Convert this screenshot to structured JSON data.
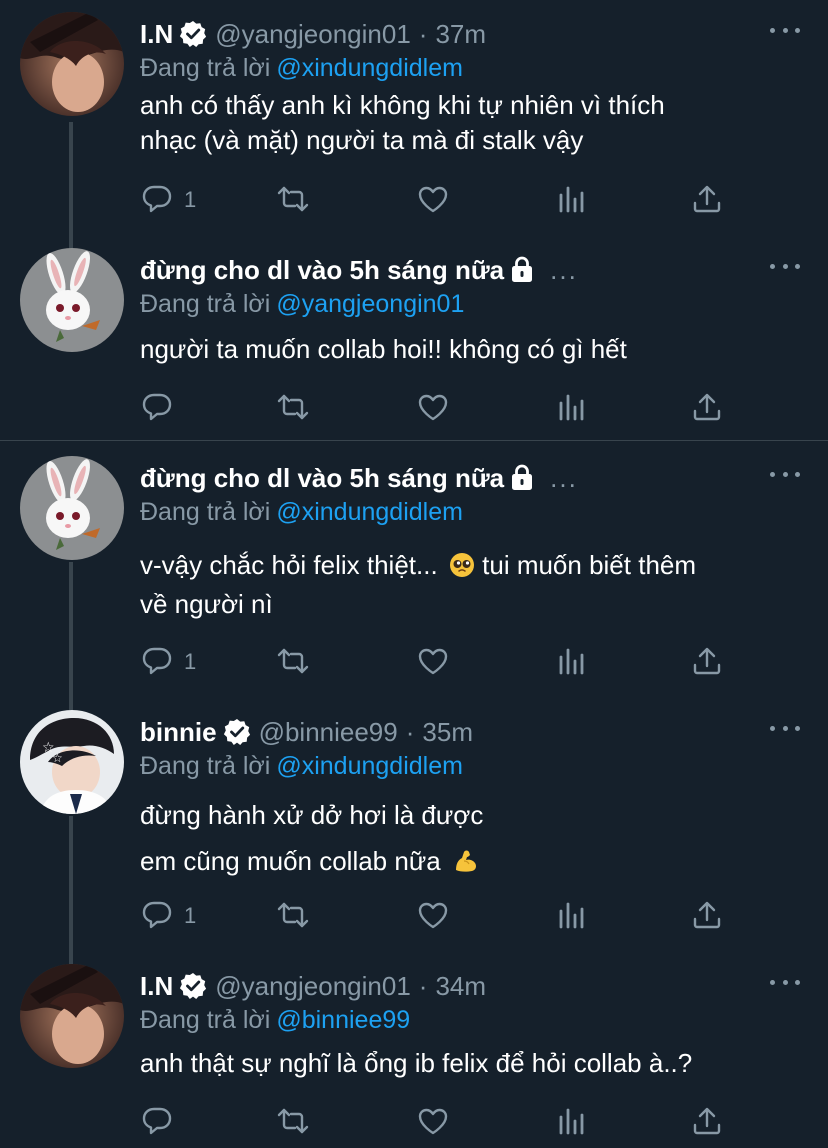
{
  "tweets": [
    {
      "name": "I.N",
      "verified": true,
      "handle": "@yangjeongin01",
      "time": "37m",
      "reply_prefix": "Đang trả lời",
      "reply_to": "@xindungdidlem",
      "lines": [
        "anh có thấy anh kì không khi tự nhiên vì thích",
        "nhạc (và mặt) người ta mà đi stalk vậy"
      ],
      "reply_count": "1"
    },
    {
      "name": "đừng cho dl vào 5h sáng nữa",
      "protected": true,
      "name_truncated": "...",
      "reply_prefix": "Đang trả lời",
      "reply_to": "@yangjeongin01",
      "lines": [
        "người ta muốn collab hoi!! không có gì hết"
      ],
      "reply_count": ""
    },
    {
      "name": "đừng cho dl vào 5h sáng nữa",
      "protected": true,
      "name_truncated": "...",
      "reply_prefix": "Đang trả lời",
      "reply_to": "@xindungdidlem",
      "lines": [
        "v-vậy chắc hỏi felix thiệt... ",
        "về người nì"
      ],
      "line1_after_emoji": " tui muốn biết thêm",
      "emoji": "pleading-face",
      "reply_count": "1"
    },
    {
      "name": "binnie",
      "verified": true,
      "handle": "@binniee99",
      "time": "35m",
      "reply_prefix": "Đang trả lời",
      "reply_to": "@xindungdidlem",
      "lines": [
        "đừng hành xử dở hơi là được",
        "em cũng muốn collab nữa "
      ],
      "emoji": "flexed-biceps",
      "reply_count": "1"
    },
    {
      "name": "I.N",
      "verified": true,
      "handle": "@yangjeongin01",
      "time": "34m",
      "reply_prefix": "Đang trả lời",
      "reply_to": "@binniee99",
      "lines": [
        "anh thật sự nghĩ là ổng ib felix để hỏi collab à..?"
      ],
      "reply_count": ""
    }
  ],
  "separator": "·",
  "icons": [
    "reply-icon",
    "retweet-icon",
    "like-icon",
    "analytics-icon",
    "share-icon",
    "more-icon",
    "verified-badge-icon",
    "lock-icon"
  ],
  "colors": {
    "background": "#15202b",
    "secondary_text": "#8899a6",
    "link": "#1da1f2",
    "line": "#38444d"
  }
}
